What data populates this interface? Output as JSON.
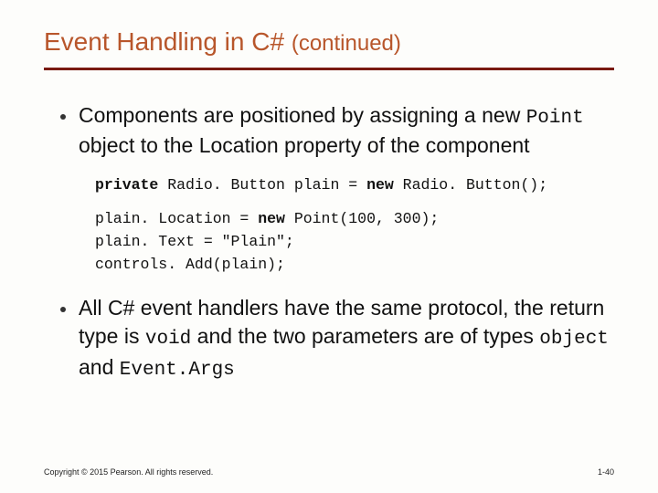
{
  "title_main": "Event Handling in C# ",
  "title_cont": "(continued)",
  "bullet1_a": "Components are positioned by assigning a new ",
  "bullet1_mono": "Point",
  "bullet1_b": " object to the Location property of the component",
  "code": {
    "l1a": "private",
    "l1b": " Radio. Button plain = ",
    "l1c": "new",
    "l1d": " Radio. Button();",
    "l2a": "plain. Location = ",
    "l2b": "new",
    "l2c": " Point(100, 300);",
    "l3": "plain. Text = \"Plain\";",
    "l4": "controls. Add(plain);"
  },
  "bullet2_a": "All C# event handlers have the same protocol, the return type is ",
  "bullet2_mono1": "void",
  "bullet2_b": " and the two parameters are of types ",
  "bullet2_mono2": "object",
  "bullet2_c": " and ",
  "bullet2_mono3": "Event.Args",
  "copyright": "Copyright © 2015 Pearson. All rights reserved.",
  "pagenum": "1-40"
}
